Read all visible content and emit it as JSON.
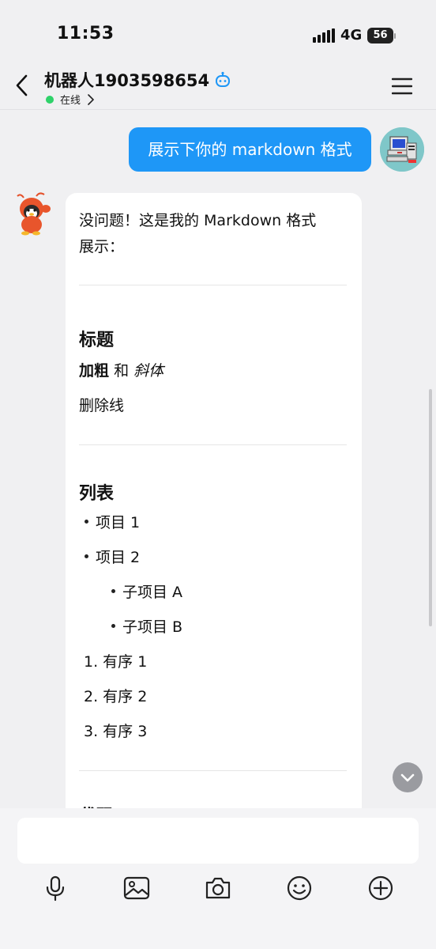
{
  "status_bar": {
    "time": "11:53",
    "network": "4G",
    "battery": "56"
  },
  "header": {
    "title": "机器人1903598654",
    "status": "在线"
  },
  "messages": {
    "user_text": "展示下你的 markdown 格式",
    "bot": {
      "intro_line1": "没问题！这是我的 Markdown 格式",
      "intro_line2": "展示：",
      "heading_title": "标题",
      "bold_text": "加粗",
      "and_text": "和",
      "italic_text": "斜体",
      "strike_text": "删除线",
      "heading_list": "列表",
      "list_items": [
        "项目 1",
        "项目 2"
      ],
      "sub_items": [
        "子项目 A",
        "子项目 B"
      ],
      "ordered_items": [
        "1. 有序 1",
        "2. 有序 2",
        "3. 有序 3"
      ],
      "partial_heading": "代码"
    }
  },
  "input": {
    "placeholder": ""
  },
  "toolbar": {
    "icons": [
      "microphone-icon",
      "image-icon",
      "camera-icon",
      "emoji-icon",
      "plus-icon"
    ]
  },
  "colors": {
    "user_bubble": "#1e97f7",
    "online_dot": "#2fd26a",
    "robot_icon": "#1e97f7"
  }
}
